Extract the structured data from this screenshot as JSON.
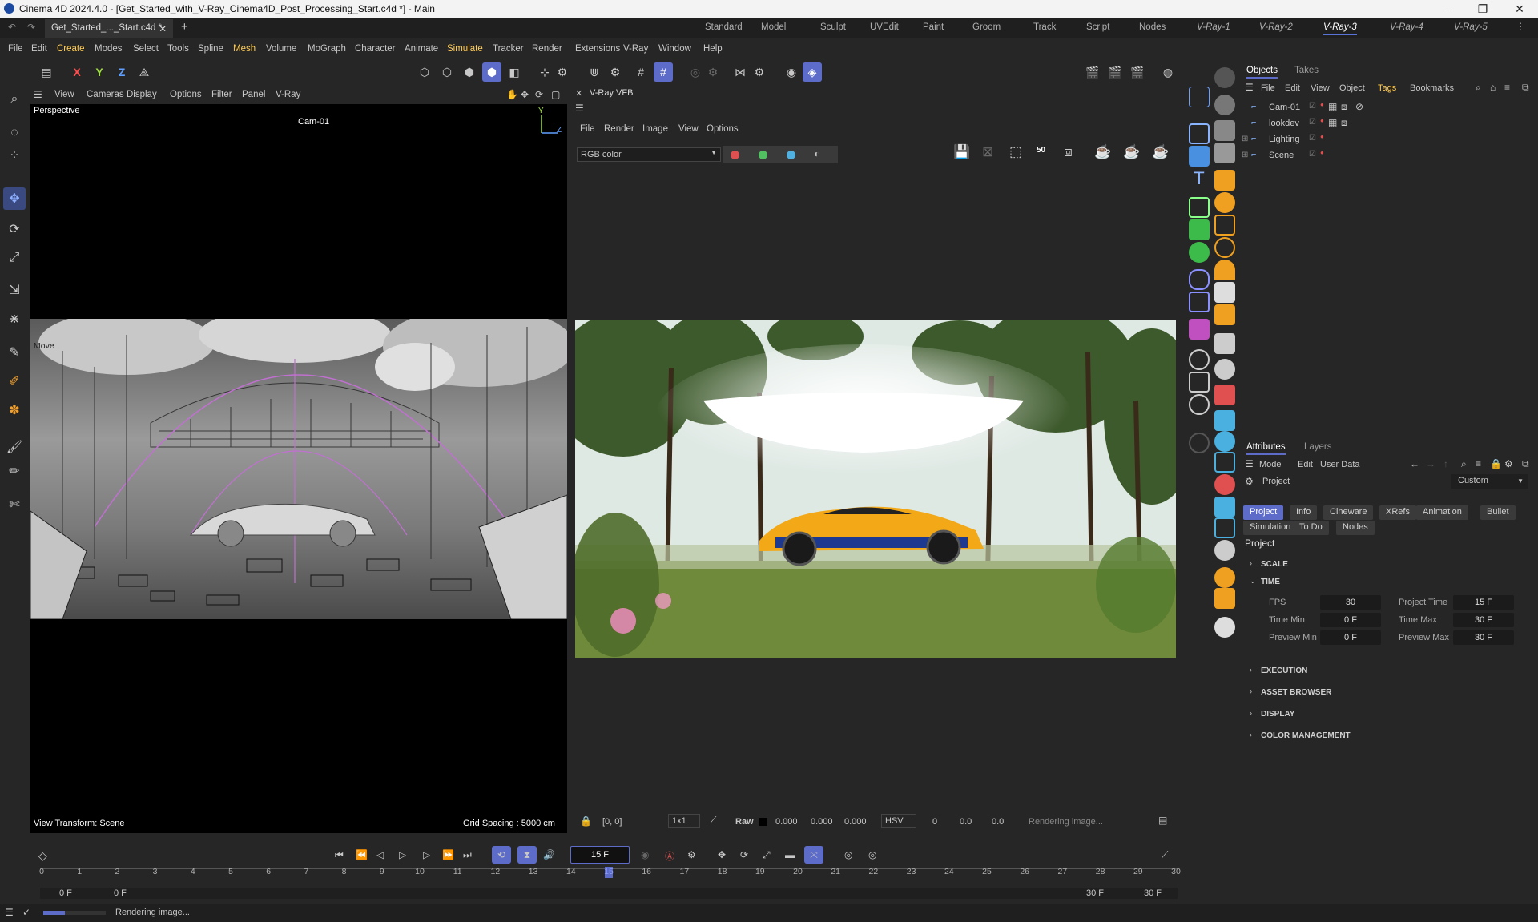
{
  "window": {
    "title": "Cinema 4D 2024.4.0 - [Get_Started_with_V-Ray_Cinema4D_Post_Processing_Start.c4d *] - Main",
    "controls": [
      "–",
      "❐",
      "✕"
    ]
  },
  "tabbar": {
    "doc_tab": "Get_Started_..._Start.c4d *",
    "doc_close": "✕",
    "add": "+",
    "layouts": [
      "Standard",
      "Model",
      "Sculpt",
      "UVEdit",
      "Paint",
      "Groom",
      "Track",
      "Script",
      "Nodes",
      "V-Ray-1",
      "V-Ray-2",
      "V-Ray-3",
      "V-Ray-4",
      "V-Ray-5"
    ],
    "active_layout": "V-Ray-3"
  },
  "menubar": [
    "File",
    "Edit",
    "Create",
    "Modes",
    "Select",
    "Tools",
    "Spline",
    "Mesh",
    "Volume",
    "MoGraph",
    "Character",
    "Animate",
    "Simulate",
    "Tracker",
    "Render",
    "Extensions",
    "V-Ray",
    "Window",
    "Help"
  ],
  "toolbar": {
    "axes": [
      "X",
      "Y",
      "Z"
    ]
  },
  "viewport": {
    "menus": [
      "View",
      "Cameras",
      "Display",
      "Options",
      "Filter",
      "Panel",
      "V-Ray"
    ],
    "name": "Perspective",
    "camera": "Cam-01",
    "tool_label": "Move",
    "view_transform": "View Transform: Scene",
    "grid_spacing": "Grid Spacing : 5000 cm",
    "axis_labels": [
      "Y",
      "Z"
    ]
  },
  "vfb": {
    "title": "V-Ray VFB",
    "menus": [
      "File",
      "Render",
      "Image",
      "View",
      "Options"
    ],
    "channel": "RGB color",
    "zoom_badge": "50",
    "coords": "[0, 0]",
    "ratio": "1x1",
    "raw_label": "Raw",
    "raw_values": [
      "0.000",
      "0.000",
      "0.000"
    ],
    "color_mode": "HSV",
    "hsv_values": [
      "0",
      "0.0",
      "0.0"
    ],
    "status": "Rendering image..."
  },
  "objects_panel": {
    "tabs": [
      "Objects",
      "Takes"
    ],
    "menus": [
      "File",
      "Edit",
      "View",
      "Object",
      "Tags",
      "Bookmarks"
    ],
    "items": [
      "Cam-01",
      "lookdev",
      "Lighting",
      "Scene"
    ]
  },
  "attributes_panel": {
    "tabs": [
      "Attributes",
      "Layers"
    ],
    "menus": [
      "Mode",
      "Edit",
      "User Data"
    ],
    "object": "Project",
    "preset": "Custom",
    "sub_tabs_row1": [
      "Project",
      "Info",
      "Cineware",
      "XRefs",
      "Animation",
      "Bullet"
    ],
    "sub_tabs_row2": [
      "Simulation",
      "To Do",
      "Nodes"
    ],
    "active_sub_tab": "Project",
    "heading": "Project",
    "sections_top": [
      "SCALE",
      "TIME"
    ],
    "time_fields": [
      {
        "label": "FPS",
        "value": "30"
      },
      {
        "label": "Project Time",
        "value": "15 F"
      },
      {
        "label": "Time Min",
        "value": "0 F"
      },
      {
        "label": "Time Max",
        "value": "30 F"
      },
      {
        "label": "Preview Min",
        "value": "0 F"
      },
      {
        "label": "Preview Max",
        "value": "30 F"
      }
    ],
    "sections_bottom": [
      "EXECUTION",
      "ASSET BROWSER",
      "DISPLAY",
      "COLOR MANAGEMENT"
    ]
  },
  "timeline": {
    "current_frame": "15 F",
    "frame_marks": [
      "0",
      "1",
      "2",
      "3",
      "4",
      "5",
      "6",
      "7",
      "8",
      "9",
      "10",
      "11",
      "12",
      "13",
      "14",
      "15",
      "16",
      "17",
      "18",
      "19",
      "20",
      "21",
      "22",
      "23",
      "24",
      "25",
      "26",
      "27",
      "28",
      "29",
      "30"
    ],
    "current_index": 15,
    "range_start": "0 F",
    "range_start2": "0 F",
    "range_end": "30 F",
    "range_end2": "30 F"
  },
  "statusbar": {
    "text": "Rendering image...",
    "progress": 0.35
  },
  "colors": {
    "accent": "#5d6cc9",
    "bg": "#262626",
    "car": "#f2a817"
  }
}
